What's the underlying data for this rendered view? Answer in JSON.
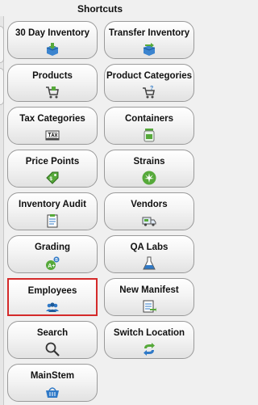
{
  "title": "Shortcuts",
  "buttons": [
    {
      "label": "30 Day Inventory",
      "icon": "box-arrow-icon"
    },
    {
      "label": "Transfer Inventory",
      "icon": "box-transfer-icon"
    },
    {
      "label": "Products",
      "icon": "cart-icon"
    },
    {
      "label": "Product Categories",
      "icon": "cart-question-icon"
    },
    {
      "label": "Tax Categories",
      "icon": "tax-icon"
    },
    {
      "label": "Containers",
      "icon": "jar-icon"
    },
    {
      "label": "Price Points",
      "icon": "price-tag-icon"
    },
    {
      "label": "Strains",
      "icon": "leaf-icon"
    },
    {
      "label": "Inventory Audit",
      "icon": "clipboard-icon"
    },
    {
      "label": "Vendors",
      "icon": "truck-icon"
    },
    {
      "label": "Grading",
      "icon": "grade-icon"
    },
    {
      "label": "QA Labs",
      "icon": "flask-icon"
    },
    {
      "label": "Employees",
      "icon": "people-icon"
    },
    {
      "label": "New Manifest",
      "icon": "manifest-icon"
    },
    {
      "label": "Search",
      "icon": "magnifier-icon"
    },
    {
      "label": "Switch Location",
      "icon": "refresh-arrows-icon"
    },
    {
      "label": "MainStem",
      "icon": "basket-icon"
    }
  ],
  "colors": {
    "selected_border": "#d42a2a",
    "accent_blue": "#2f79c7",
    "accent_green": "#56a93a"
  }
}
